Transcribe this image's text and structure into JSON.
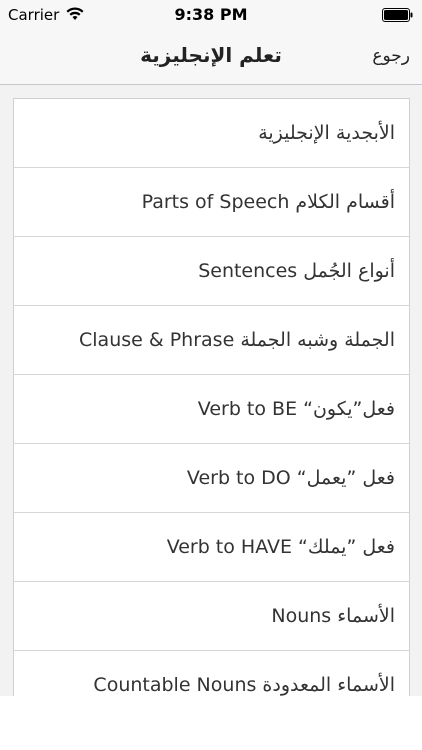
{
  "status_bar": {
    "carrier": "Carrier",
    "time": "9:38 PM"
  },
  "nav": {
    "title": "تعلم الإنجليزية",
    "back_label": "رجوع"
  },
  "list": {
    "items": [
      {
        "label": "الأبجدية الإنجليزية"
      },
      {
        "label": "Parts of Speech أقسام الكلام"
      },
      {
        "label": "Sentences أنواع الجُمل"
      },
      {
        "label": "Clause & Phrase الجملة وشبه الجملة"
      },
      {
        "label": "Verb to BE “فعل”يكون"
      },
      {
        "label": "Verb to DO “فعل ”يعمل"
      },
      {
        "label": "Verb to HAVE “فعل ”يملك"
      },
      {
        "label": "Nouns الأسماء"
      },
      {
        "label": "Countable Nouns الأسماء المعدودة"
      }
    ]
  }
}
